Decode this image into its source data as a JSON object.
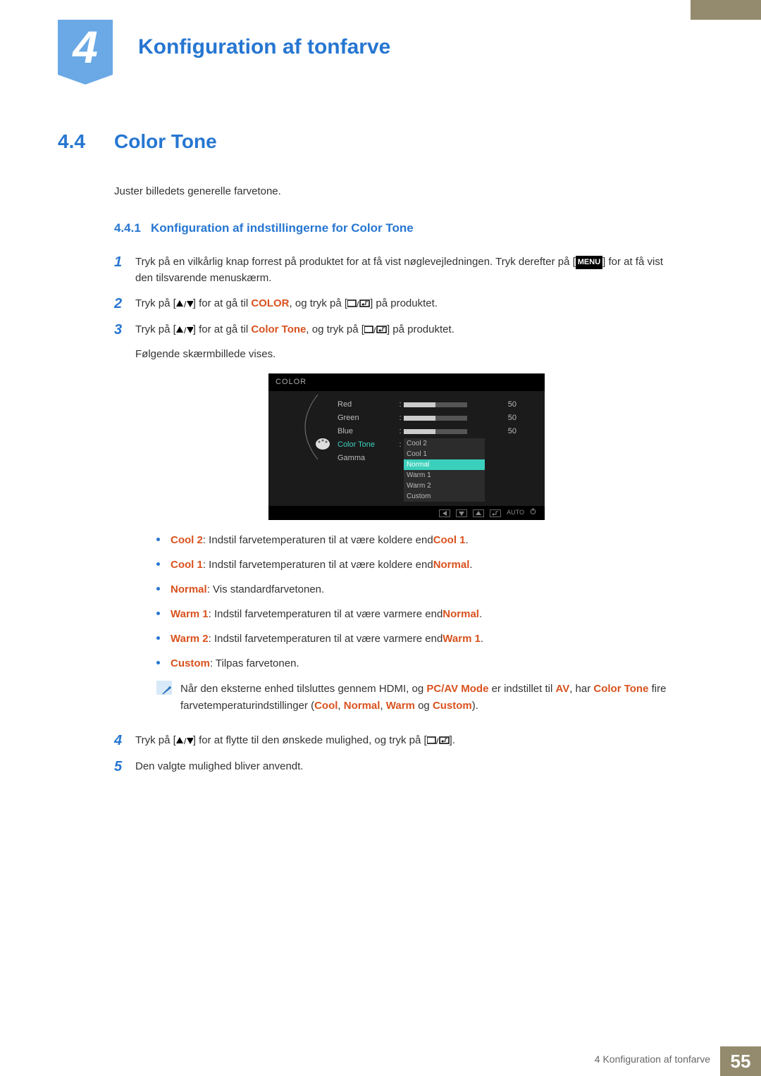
{
  "chapter": {
    "number": "4",
    "title": "Konfiguration af tonfarve"
  },
  "section": {
    "number": "4.4",
    "title": "Color Tone"
  },
  "intro": "Juster billedets generelle farvetone.",
  "subsection": {
    "number": "4.4.1",
    "title": "Konfiguration af indstillingerne for Color Tone"
  },
  "steps": {
    "s1a": "Tryk på en vilkårlig knap forrest på produktet for at få vist nøglevejledningen. Tryk derefter på [",
    "menu_label": "MENU",
    "s1b": "] for at få vist den tilsvarende menuskærm.",
    "s2a": "Tryk på [",
    "s2b": "] for at gå til ",
    "color": "COLOR",
    "s2c": ", og tryk på [",
    "s2d": "] på produktet.",
    "s3a": "Tryk på [",
    "s3b": "] for at gå til ",
    "color_tone": "Color Tone",
    "s3c": ", og tryk på [",
    "s3d": "] på produktet.",
    "s3_sub": "Følgende skærmbillede vises.",
    "s4a": "Tryk på [",
    "s4b": "] for at flytte til den ønskede mulighed, og tryk på [",
    "s4c": "].",
    "s5": "Den valgte mulighed bliver anvendt."
  },
  "osd": {
    "header": "COLOR",
    "rows": {
      "red": "Red",
      "green": "Green",
      "blue": "Blue",
      "color_tone": "Color Tone",
      "gamma": "Gamma"
    },
    "values": {
      "red": "50",
      "green": "50",
      "blue": "50"
    },
    "options": {
      "cool2": "Cool 2",
      "cool1": "Cool 1",
      "normal": "Normal",
      "warm1": "Warm 1",
      "warm2": "Warm 2",
      "custom": "Custom"
    },
    "footer_auto": "AUTO"
  },
  "bullets": {
    "cool2_l": "Cool 2",
    "cool2_t": ": Indstil farvetemperaturen til at være koldere end ",
    "cool2_r": "Cool 1",
    "cool2_e": ".",
    "cool1_l": "Cool 1",
    "cool1_t": ": Indstil farvetemperaturen til at være koldere end ",
    "cool1_r": "Normal",
    "cool1_e": ".",
    "normal_l": "Normal",
    "normal_t": ": Vis standardfarvetonen.",
    "warm1_l": "Warm 1",
    "warm1_t": ": Indstil farvetemperaturen til at være varmere end ",
    "warm1_r": "Normal",
    "warm1_e": ".",
    "warm2_l": "Warm 2",
    "warm2_t": ": Indstil farvetemperaturen til at være varmere end ",
    "warm2_r": "Warm 1",
    "warm2_e": ".",
    "custom_l": "Custom",
    "custom_t": ": Tilpas farvetonen."
  },
  "note": {
    "a": "Når den eksterne enhed tilsluttes gennem HDMI, og ",
    "pcav": "PC/AV Mode",
    "b": " er indstillet til ",
    "av": "AV",
    "c": ", har ",
    "ct": "Color Tone",
    "d": " fire farvetemperaturindstillinger (",
    "cool": "Cool",
    "sep1": ", ",
    "normal": "Normal",
    "sep2": ", ",
    "warm": "Warm",
    "sep3": " og ",
    "custom": "Custom",
    "e": ")."
  },
  "footer": {
    "text": "4 Konfiguration af tonfarve",
    "page": "55"
  }
}
